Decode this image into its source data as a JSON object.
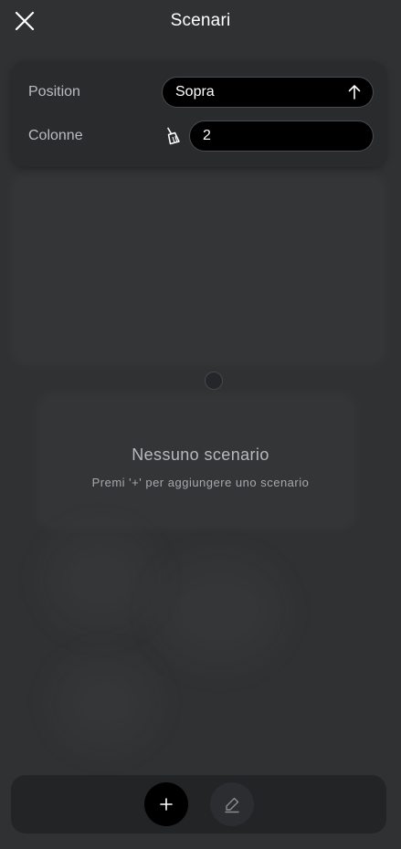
{
  "header": {
    "title": "Scenari"
  },
  "settings": {
    "position_label": "Position",
    "position_value": "Sopra",
    "columns_label": "Colonne",
    "columns_value": "2"
  },
  "empty_state": {
    "title": "Nessuno scenario",
    "subtitle": "Premi '+' per aggiungere uno scenario"
  },
  "icons": {
    "close": "close-icon",
    "sort": "arrow-up-icon",
    "clear": "broom-icon",
    "add": "plus-icon",
    "edit": "pencil-icon"
  },
  "colors": {
    "background": "#303133",
    "card": "#2a2b2d",
    "pill": "#000000",
    "text": "#ffffff",
    "muted_text": "#b7b9bd"
  }
}
